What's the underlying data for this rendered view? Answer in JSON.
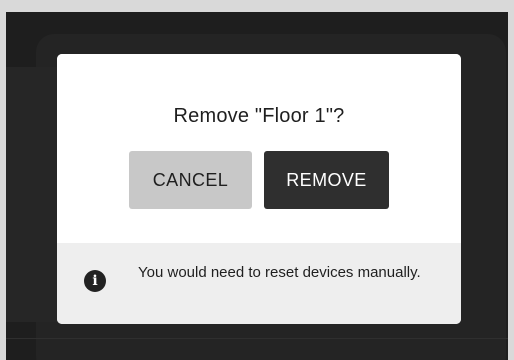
{
  "dialog": {
    "title": "Remove \"Floor 1\"?",
    "cancel_label": "CANCEL",
    "remove_label": "REMOVE",
    "info_icon_glyph": "i",
    "info_text": "You would need to reset devices manually."
  },
  "icons": {
    "info": "info-icon"
  },
  "colors": {
    "backdrop": "#1e1e1e",
    "dialog_background": "#ffffff",
    "footer_background": "#eeeeee",
    "cancel_button": "#c8c8c8",
    "remove_button": "#2f2f2f"
  }
}
